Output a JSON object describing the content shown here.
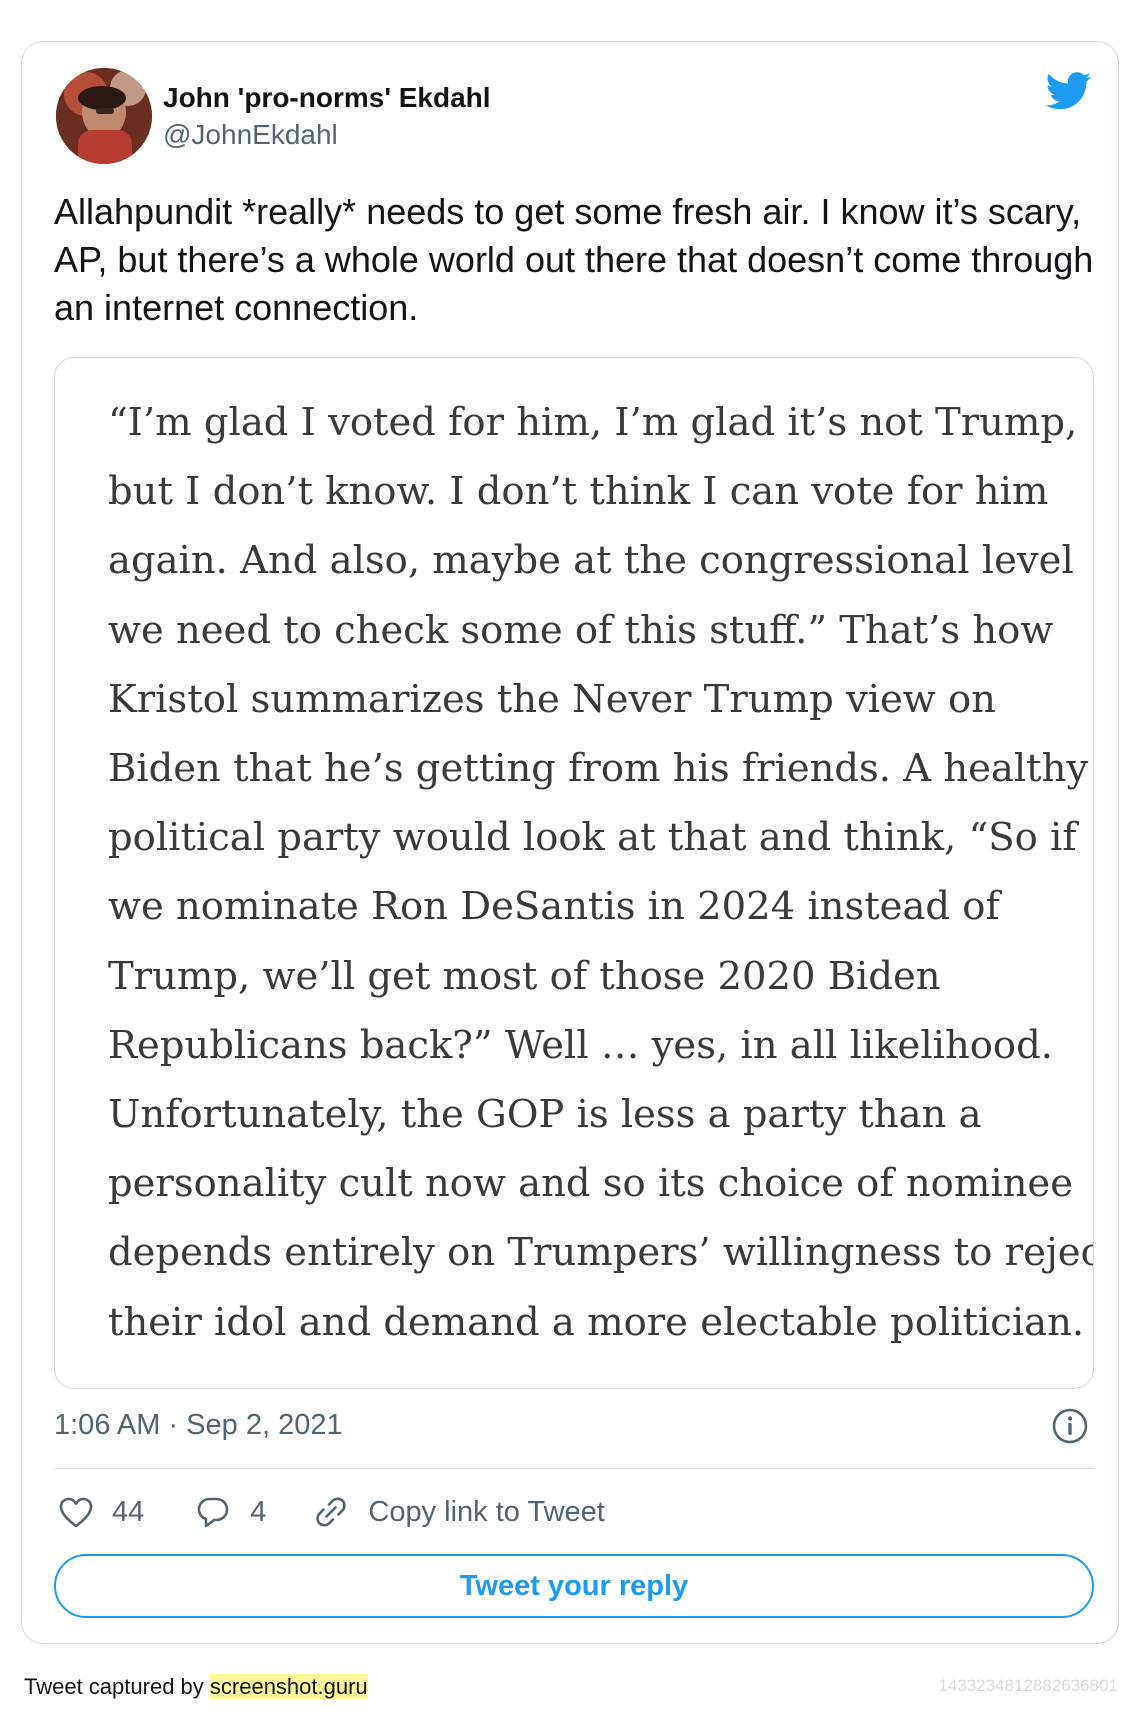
{
  "tweet": {
    "author": {
      "name": "John 'pro-norms' Ekdahl",
      "handle": "@JohnEkdahl",
      "avatar_icon": "profile-photo"
    },
    "brand_icon": "twitter-bird-icon",
    "text": "Allahpundit *really* needs to get some fresh air. I know it’s scary, AP, but there’s a whole world out there that doesn’t come through an internet connection.",
    "media_excerpt_lines": [
      "“I’m glad I voted for him, I’m glad it’s not Trump,",
      "but I don’t know. I don’t think I can vote for him",
      "again. And also, maybe at the congressional level",
      "we need to check some of this stuff.” That’s how",
      "Kristol summarizes the Never Trump view on",
      "Biden that he’s getting from his friends. A healthy",
      "political party would look at that and think, “So if",
      "we nominate Ron DeSantis in 2024 instead of",
      "Trump, we’ll get most of those 2020 Biden",
      "Republicans back?” Well … yes, in all likelihood.",
      "Unfortunately, the GOP is less a party than a",
      "personality cult now and so its choice of nominee",
      "depends entirely on Trumpers’ willingness to reject",
      "their idol and demand a more electable politician."
    ],
    "timestamp": "1:06 AM · Sep 2, 2021",
    "info_icon": "info-icon",
    "actions": {
      "likes": "44",
      "replies": "4",
      "copy_link_label": "Copy link to Tweet"
    },
    "reply_button_label": "Tweet your reply"
  },
  "footer": {
    "captured_prefix": "Tweet captured by ",
    "captured_brand": "screenshot.guru",
    "tweet_id": "1433234812882636801"
  },
  "colors": {
    "accent": "#1d9bf0",
    "text_primary": "#0f1419",
    "text_secondary": "#536471",
    "border": "#cfd9de",
    "highlight": "#fff89a"
  }
}
